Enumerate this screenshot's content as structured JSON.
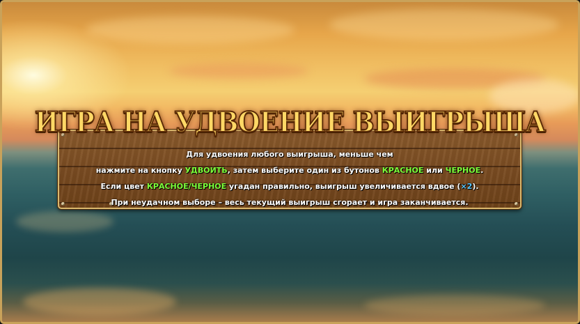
{
  "title": "ИГРА НА УДВОЕНИЕ ВЫИГРЫША",
  "rules": {
    "line1": "Для удвоения любого выигрыша, меньше чем",
    "line2_a": "нажмите на кнопку ",
    "line2_double": "УДВОИТЬ",
    "line2_b": ", затем выберите один из бутонов ",
    "line2_red": "КРАСНОЕ",
    "line2_c": " или ",
    "line2_black": "ЧЕРНОЕ",
    "line2_d": ".",
    "line3_a": "Если цвет ",
    "line3_color": "КРАСНОЕ/ЧЕРНОЕ",
    "line3_b": " угадан правильно, выигрыш увеличивается вдвое (",
    "line3_mult": "×2",
    "line3_c": ").",
    "line4": "При неудачном выборе – весь текущий выигрыш сгорает и игра заканчивается."
  },
  "colors": {
    "title": "#ffd866",
    "highlight_green": "#7dff3a",
    "highlight_blue": "#57c7ff",
    "board_wood": "#7a4c22",
    "frame_gold": "#c9a25a"
  }
}
